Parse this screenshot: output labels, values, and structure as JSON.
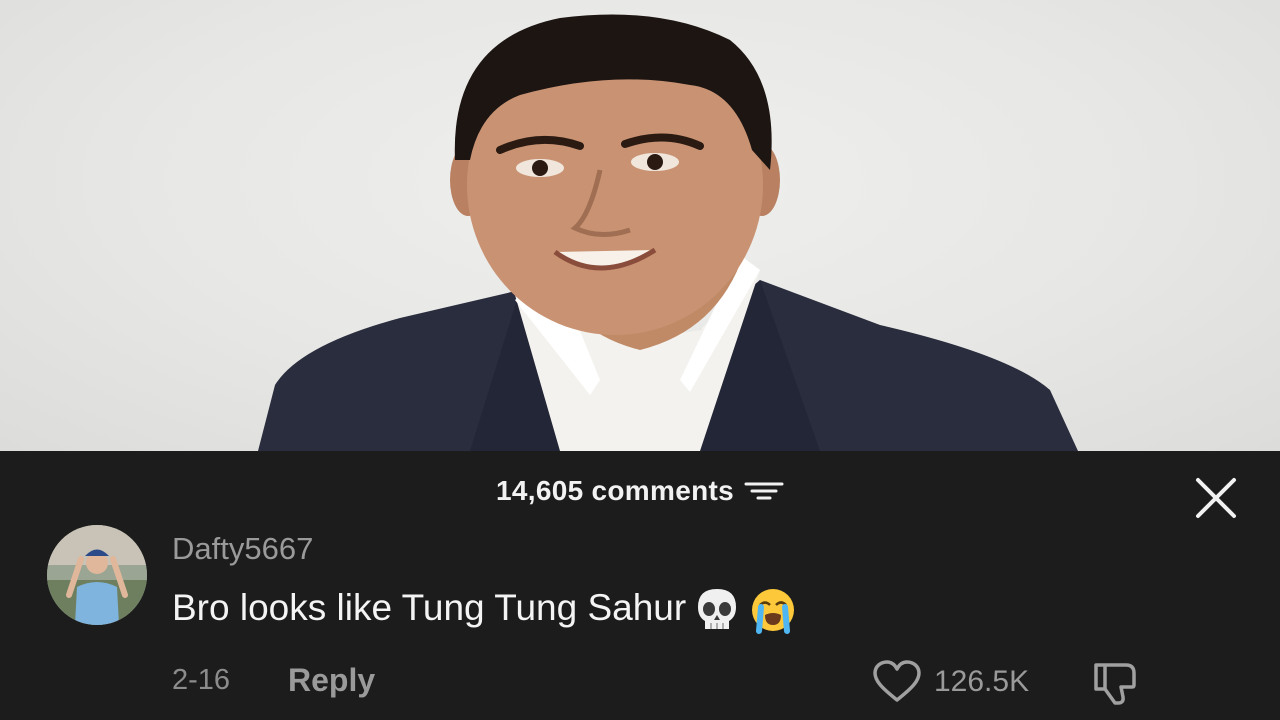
{
  "header": {
    "comments_label": "14,605 comments"
  },
  "comment": {
    "username": "Dafty5667",
    "text": "Bro looks like Tung Tung Sahur",
    "emojis": [
      "skull-emoji",
      "loudly-crying-face-emoji"
    ],
    "date": "2-16",
    "reply_label": "Reply",
    "like_count": "126.5K"
  },
  "icons": {
    "sort": "sort-filter-icon",
    "close": "close-icon",
    "like": "heart-icon",
    "dislike": "thumbs-down-icon"
  },
  "colors": {
    "sheet_background": "#1c1c1c",
    "primary_text": "#f4f4f4",
    "secondary_text": "#9a9a9a"
  }
}
